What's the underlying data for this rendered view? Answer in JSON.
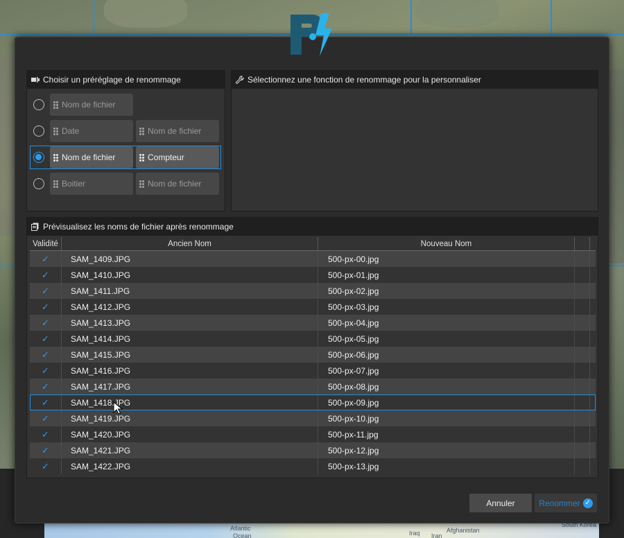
{
  "preset_panel": {
    "title": "Choisir un préréglage de renommage"
  },
  "presets": [
    {
      "chips": [
        "Nom de fichier"
      ],
      "selected": false
    },
    {
      "chips": [
        "Date",
        "Nom de fichier"
      ],
      "selected": false
    },
    {
      "chips": [
        "Nom de fichier",
        "Compteur"
      ],
      "selected": true
    },
    {
      "chips": [
        "Boitier",
        "Nom de fichier"
      ],
      "selected": false
    }
  ],
  "function_panel": {
    "title": "Sélectionnez une fonction de renommage pour la personnaliser"
  },
  "preview_panel": {
    "title": "Prévisualisez les noms de fichier après renommage"
  },
  "table": {
    "columns": [
      "Validité",
      "Ancien Nom",
      "Nouveau Nom"
    ],
    "rows": [
      {
        "valid": "✓",
        "old": "SAM_1409.JPG",
        "new": "500-px-00.jpg"
      },
      {
        "valid": "✓",
        "old": "SAM_1410.JPG",
        "new": "500-px-01.jpg"
      },
      {
        "valid": "✓",
        "old": "SAM_1411.JPG",
        "new": "500-px-02.jpg"
      },
      {
        "valid": "✓",
        "old": "SAM_1412.JPG",
        "new": "500-px-03.jpg"
      },
      {
        "valid": "✓",
        "old": "SAM_1413.JPG",
        "new": "500-px-04.jpg"
      },
      {
        "valid": "✓",
        "old": "SAM_1414.JPG",
        "new": "500-px-05.jpg"
      },
      {
        "valid": "✓",
        "old": "SAM_1415.JPG",
        "new": "500-px-06.jpg"
      },
      {
        "valid": "✓",
        "old": "SAM_1416.JPG",
        "new": "500-px-07.jpg"
      },
      {
        "valid": "✓",
        "old": "SAM_1417.JPG",
        "new": "500-px-08.jpg"
      },
      {
        "valid": "✓",
        "old": "SAM_1418.JPG",
        "new": "500-px-09.jpg"
      },
      {
        "valid": "✓",
        "old": "SAM_1419.JPG",
        "new": "500-px-10.jpg"
      },
      {
        "valid": "✓",
        "old": "SAM_1420.JPG",
        "new": "500-px-11.jpg"
      },
      {
        "valid": "✓",
        "old": "SAM_1421.JPG",
        "new": "500-px-12.jpg"
      },
      {
        "valid": "✓",
        "old": "SAM_1422.JPG",
        "new": "500-px-13.jpg"
      }
    ],
    "selected_row": 9
  },
  "buttons": {
    "cancel": "Annuler",
    "ok": "Renommer"
  },
  "background_map": {
    "labels": [
      "Atlantic",
      "Ocean",
      "Iraq",
      "Iran",
      "Afghanistan",
      "South Korea"
    ]
  },
  "colors": {
    "accent": "#1e90e6",
    "dialog_bg": "#2b2b2b",
    "header_bg": "#1f1f1f"
  }
}
